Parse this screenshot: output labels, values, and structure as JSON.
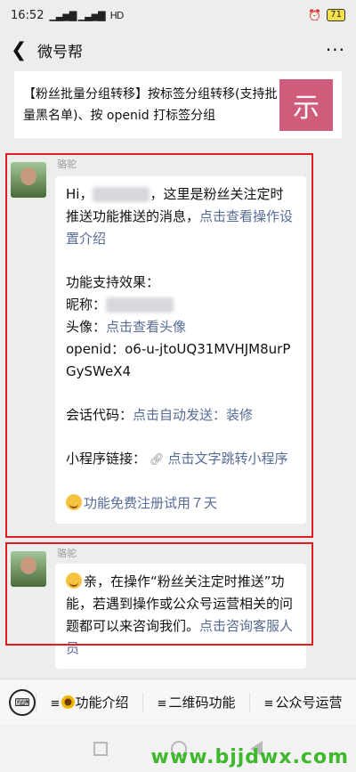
{
  "status": {
    "time": "16:52",
    "signal": "▁▃▅▇ ▁▃▅▇",
    "network": "HD",
    "battery": "71"
  },
  "nav": {
    "back": "❮",
    "title": "微号帮",
    "more": "···"
  },
  "article": {
    "text": "【粉丝批量分组转移】按标签分组转移(支持批量黑名单)、按 openid 打标签分组",
    "thumb": "示"
  },
  "msg1": {
    "sender": "骆驼",
    "greeting": "Hi，",
    "intro": "，这里是粉丝关注定时推送功能推送的消息，",
    "intro_link": "点击查看操作设置介绍",
    "effects_title": "功能支持效果：",
    "nickname_label": "昵称：",
    "avatar_label": "头像：",
    "avatar_link": "点击查看头像",
    "openid_label": "openid：",
    "openid_value": "o6-u-jtoUQ31MVHJM8urPGySWeX4",
    "session_label": "会话代码：",
    "session_link": "点击自动发送：装修",
    "mini_label": "小程序链接：",
    "mini_link": "点击文字跳转小程序",
    "trial_link": "功能免费注册试用７天"
  },
  "msg2": {
    "sender": "骆驼",
    "text": "亲，在操作“粉丝关注定时推送”功能，若遇到操作或公众号运营相关的问题都可以来咨询我们。",
    "link": "点击咨询客服人员"
  },
  "bottom_menu": {
    "keyboard": "⌨",
    "items": [
      {
        "label": "功能介绍"
      },
      {
        "label": "二维码功能"
      },
      {
        "label": "公众号运营"
      }
    ]
  },
  "watermark": "www.bjjdwx.com"
}
